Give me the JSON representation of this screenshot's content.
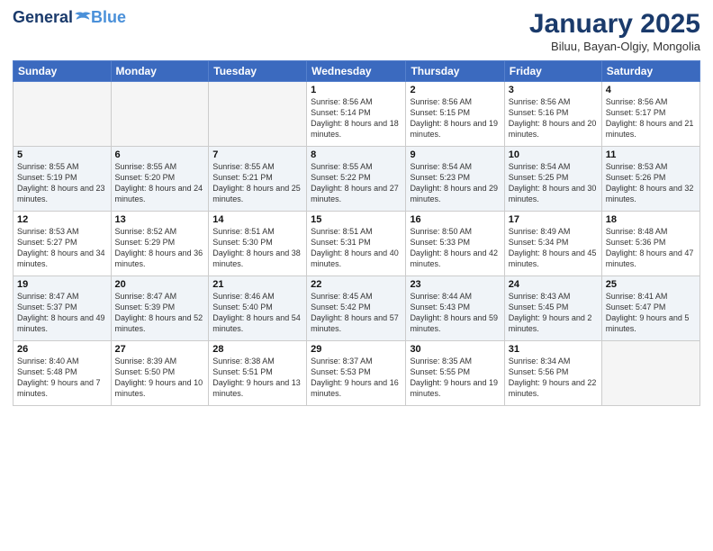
{
  "header": {
    "logo_general": "General",
    "logo_blue": "Blue",
    "month_title": "January 2025",
    "subtitle": "Biluu, Bayan-Olgiy, Mongolia"
  },
  "days_of_week": [
    "Sunday",
    "Monday",
    "Tuesday",
    "Wednesday",
    "Thursday",
    "Friday",
    "Saturday"
  ],
  "weeks": [
    [
      {
        "day": "",
        "sunrise": "",
        "sunset": "",
        "daylight": ""
      },
      {
        "day": "",
        "sunrise": "",
        "sunset": "",
        "daylight": ""
      },
      {
        "day": "",
        "sunrise": "",
        "sunset": "",
        "daylight": ""
      },
      {
        "day": "1",
        "sunrise": "Sunrise: 8:56 AM",
        "sunset": "Sunset: 5:14 PM",
        "daylight": "Daylight: 8 hours and 18 minutes."
      },
      {
        "day": "2",
        "sunrise": "Sunrise: 8:56 AM",
        "sunset": "Sunset: 5:15 PM",
        "daylight": "Daylight: 8 hours and 19 minutes."
      },
      {
        "day": "3",
        "sunrise": "Sunrise: 8:56 AM",
        "sunset": "Sunset: 5:16 PM",
        "daylight": "Daylight: 8 hours and 20 minutes."
      },
      {
        "day": "4",
        "sunrise": "Sunrise: 8:56 AM",
        "sunset": "Sunset: 5:17 PM",
        "daylight": "Daylight: 8 hours and 21 minutes."
      }
    ],
    [
      {
        "day": "5",
        "sunrise": "Sunrise: 8:55 AM",
        "sunset": "Sunset: 5:19 PM",
        "daylight": "Daylight: 8 hours and 23 minutes."
      },
      {
        "day": "6",
        "sunrise": "Sunrise: 8:55 AM",
        "sunset": "Sunset: 5:20 PM",
        "daylight": "Daylight: 8 hours and 24 minutes."
      },
      {
        "day": "7",
        "sunrise": "Sunrise: 8:55 AM",
        "sunset": "Sunset: 5:21 PM",
        "daylight": "Daylight: 8 hours and 25 minutes."
      },
      {
        "day": "8",
        "sunrise": "Sunrise: 8:55 AM",
        "sunset": "Sunset: 5:22 PM",
        "daylight": "Daylight: 8 hours and 27 minutes."
      },
      {
        "day": "9",
        "sunrise": "Sunrise: 8:54 AM",
        "sunset": "Sunset: 5:23 PM",
        "daylight": "Daylight: 8 hours and 29 minutes."
      },
      {
        "day": "10",
        "sunrise": "Sunrise: 8:54 AM",
        "sunset": "Sunset: 5:25 PM",
        "daylight": "Daylight: 8 hours and 30 minutes."
      },
      {
        "day": "11",
        "sunrise": "Sunrise: 8:53 AM",
        "sunset": "Sunset: 5:26 PM",
        "daylight": "Daylight: 8 hours and 32 minutes."
      }
    ],
    [
      {
        "day": "12",
        "sunrise": "Sunrise: 8:53 AM",
        "sunset": "Sunset: 5:27 PM",
        "daylight": "Daylight: 8 hours and 34 minutes."
      },
      {
        "day": "13",
        "sunrise": "Sunrise: 8:52 AM",
        "sunset": "Sunset: 5:29 PM",
        "daylight": "Daylight: 8 hours and 36 minutes."
      },
      {
        "day": "14",
        "sunrise": "Sunrise: 8:51 AM",
        "sunset": "Sunset: 5:30 PM",
        "daylight": "Daylight: 8 hours and 38 minutes."
      },
      {
        "day": "15",
        "sunrise": "Sunrise: 8:51 AM",
        "sunset": "Sunset: 5:31 PM",
        "daylight": "Daylight: 8 hours and 40 minutes."
      },
      {
        "day": "16",
        "sunrise": "Sunrise: 8:50 AM",
        "sunset": "Sunset: 5:33 PM",
        "daylight": "Daylight: 8 hours and 42 minutes."
      },
      {
        "day": "17",
        "sunrise": "Sunrise: 8:49 AM",
        "sunset": "Sunset: 5:34 PM",
        "daylight": "Daylight: 8 hours and 45 minutes."
      },
      {
        "day": "18",
        "sunrise": "Sunrise: 8:48 AM",
        "sunset": "Sunset: 5:36 PM",
        "daylight": "Daylight: 8 hours and 47 minutes."
      }
    ],
    [
      {
        "day": "19",
        "sunrise": "Sunrise: 8:47 AM",
        "sunset": "Sunset: 5:37 PM",
        "daylight": "Daylight: 8 hours and 49 minutes."
      },
      {
        "day": "20",
        "sunrise": "Sunrise: 8:47 AM",
        "sunset": "Sunset: 5:39 PM",
        "daylight": "Daylight: 8 hours and 52 minutes."
      },
      {
        "day": "21",
        "sunrise": "Sunrise: 8:46 AM",
        "sunset": "Sunset: 5:40 PM",
        "daylight": "Daylight: 8 hours and 54 minutes."
      },
      {
        "day": "22",
        "sunrise": "Sunrise: 8:45 AM",
        "sunset": "Sunset: 5:42 PM",
        "daylight": "Daylight: 8 hours and 57 minutes."
      },
      {
        "day": "23",
        "sunrise": "Sunrise: 8:44 AM",
        "sunset": "Sunset: 5:43 PM",
        "daylight": "Daylight: 8 hours and 59 minutes."
      },
      {
        "day": "24",
        "sunrise": "Sunrise: 8:43 AM",
        "sunset": "Sunset: 5:45 PM",
        "daylight": "Daylight: 9 hours and 2 minutes."
      },
      {
        "day": "25",
        "sunrise": "Sunrise: 8:41 AM",
        "sunset": "Sunset: 5:47 PM",
        "daylight": "Daylight: 9 hours and 5 minutes."
      }
    ],
    [
      {
        "day": "26",
        "sunrise": "Sunrise: 8:40 AM",
        "sunset": "Sunset: 5:48 PM",
        "daylight": "Daylight: 9 hours and 7 minutes."
      },
      {
        "day": "27",
        "sunrise": "Sunrise: 8:39 AM",
        "sunset": "Sunset: 5:50 PM",
        "daylight": "Daylight: 9 hours and 10 minutes."
      },
      {
        "day": "28",
        "sunrise": "Sunrise: 8:38 AM",
        "sunset": "Sunset: 5:51 PM",
        "daylight": "Daylight: 9 hours and 13 minutes."
      },
      {
        "day": "29",
        "sunrise": "Sunrise: 8:37 AM",
        "sunset": "Sunset: 5:53 PM",
        "daylight": "Daylight: 9 hours and 16 minutes."
      },
      {
        "day": "30",
        "sunrise": "Sunrise: 8:35 AM",
        "sunset": "Sunset: 5:55 PM",
        "daylight": "Daylight: 9 hours and 19 minutes."
      },
      {
        "day": "31",
        "sunrise": "Sunrise: 8:34 AM",
        "sunset": "Sunset: 5:56 PM",
        "daylight": "Daylight: 9 hours and 22 minutes."
      },
      {
        "day": "",
        "sunrise": "",
        "sunset": "",
        "daylight": ""
      }
    ]
  ]
}
